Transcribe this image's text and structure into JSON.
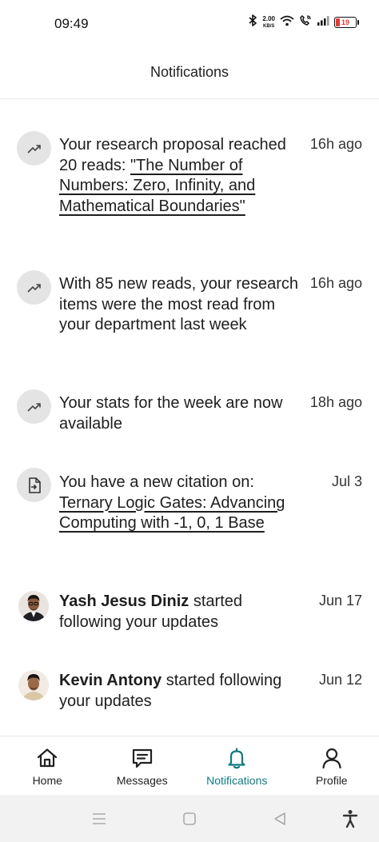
{
  "status_bar": {
    "time": "09:49",
    "net_speed_value": "2.00",
    "net_speed_unit": "KB/S",
    "battery_level": "19",
    "battery_fraction": 0.19
  },
  "header": {
    "title": "Notifications"
  },
  "notifications": [
    {
      "icon": "trending-up-icon",
      "text_before": "Your research proposal reached 20 reads: ",
      "link": "\"The Number of Numbers: Zero, Infinity, and Mathematical Boundaries\"",
      "time": "16h ago"
    },
    {
      "icon": "trending-up-icon",
      "text": "With 85 new reads, your research items were the most read from your department last week",
      "time": "16h ago"
    },
    {
      "icon": "trending-up-icon",
      "text": "Your stats for the week are now available",
      "time": "18h ago"
    },
    {
      "icon": "document-import-icon",
      "text_before": "You have a new citation on: ",
      "link": "Ternary Logic Gates: Advancing Computing with -1, 0, 1 Base",
      "time": "Jul 3"
    },
    {
      "icon": "avatar",
      "name": "Yash Jesus Diniz",
      "text_after": " started following your updates",
      "time": "Jun 17"
    },
    {
      "icon": "avatar",
      "name": "Kevin Antony",
      "text_after": " started following your updates",
      "time": "Jun 12"
    }
  ],
  "bottom_nav": {
    "items": [
      {
        "label": "Home",
        "icon": "home-icon"
      },
      {
        "label": "Messages",
        "icon": "messages-icon"
      },
      {
        "label": "Notifications",
        "icon": "bell-icon",
        "active": true
      },
      {
        "label": "Profile",
        "icon": "profile-icon"
      }
    ],
    "active_color": "#0f7b82"
  }
}
